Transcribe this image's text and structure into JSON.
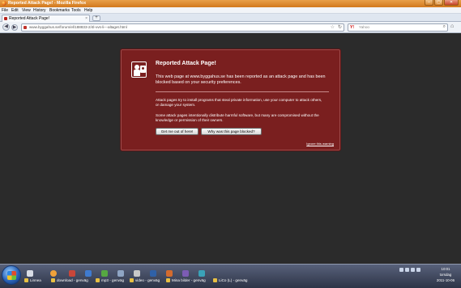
{
  "window": {
    "title": "Reported Attack Page! - Mozilla Firefox",
    "controls": {
      "minimize": "–",
      "maximize": "▢",
      "close": "✕"
    }
  },
  "menu": {
    "items": [
      "File",
      "Edit",
      "View",
      "History",
      "Bookmarks",
      "Tools",
      "Help"
    ]
  },
  "tabs": [
    {
      "label": "Reported Attack Page!",
      "close": "×"
    }
  ],
  "new_tab_label": "+",
  "nav": {
    "back": "◀",
    "forward": "▶",
    "url": "www.byggahus.se/forum/el/188833-2/4l-vvs-li---altaget.html",
    "bookmark_star": "☆",
    "reload": "↻",
    "search_engine": "Y!",
    "search_placeholder": "Yahoo",
    "search_go": "⌕",
    "home": "⌂"
  },
  "warning": {
    "heading": "Reported Attack Page!",
    "lead": "This web page at www.byggahus.se has been reported as an attack page and has been blocked based on your security preferences.",
    "para1": "Attack pages try to install programs that steal private information, use your computer to attack others, or damage your system.",
    "para2": "Some attack pages intentionally distribute harmful software, but many are compromised without the knowledge or permission of their owners.",
    "button_get_out": "Get me out of here!",
    "button_why": "Why was this page blocked?",
    "ignore_link": "Ignore this warning"
  },
  "taskbar": {
    "tasks": [
      {
        "label": "Linnea"
      },
      {
        "label": "download - genväg"
      },
      {
        "label": "mp3 - genväg"
      },
      {
        "label": "video - genväg"
      },
      {
        "label": "Mina bilder - genväg"
      },
      {
        "label": "LiCo (L) - genväg"
      }
    ],
    "clock": {
      "time": "10:01",
      "day": "torsdag",
      "date": "2011-10-06"
    }
  }
}
